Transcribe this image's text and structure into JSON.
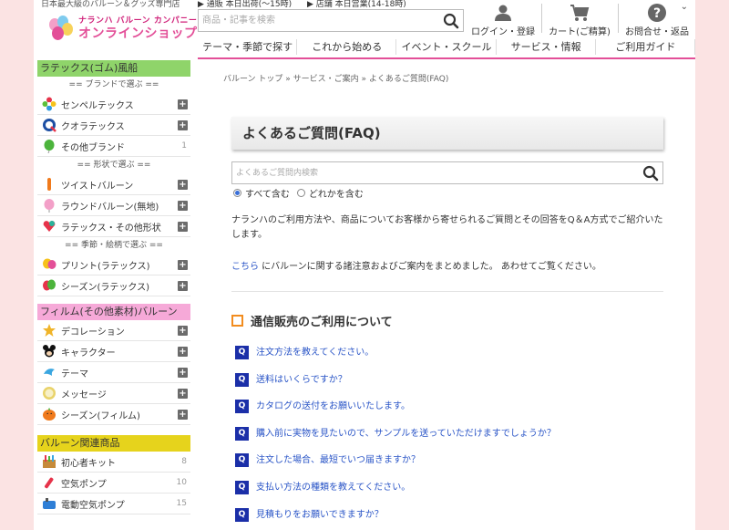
{
  "header": {
    "tagline": "日本最大級のバルーン＆グッズ専門店",
    "logo_top": "ナランハ バルーン カンパニー",
    "logo_bottom": "オンラインショップ",
    "notice_ship": "▶ 通販 本日出荷(〜15時)",
    "notice_store": "▶ 店舗 本日営業(14-18時)",
    "search_placeholder": "商品・記事を検索",
    "login_label": "ログイン・登録",
    "cart_label": "カート(ご精算)",
    "contact_label": "お問合せ・返品",
    "nav": [
      "テーマ・季節で探す",
      "これから始める",
      "イベント・スクール",
      "サービス・情報",
      "ご利用ガイド"
    ]
  },
  "sidebar": {
    "latex": {
      "title": "ラテックス(ゴム)風船",
      "brand_heading": "== ブランドで選ぶ ==",
      "brand_items": [
        {
          "label": "センペルテックス",
          "icon": "sempertex-flower-icon"
        },
        {
          "label": "クオラテックス",
          "icon": "qualatex-logo-icon"
        },
        {
          "label": "その他ブランド",
          "icon": "green-balloon-icon",
          "count": "1"
        }
      ],
      "shape_heading": "== 形状で選ぶ ==",
      "shape_items": [
        {
          "label": "ツイストバルーン",
          "icon": "twist-balloon-icon"
        },
        {
          "label": "ラウンドバルーン(無地)",
          "icon": "round-balloon-icon"
        },
        {
          "label": "ラテックス・その他形状",
          "icon": "heart-balloon-icon"
        }
      ],
      "season_heading": "== 季節・絵柄で選ぶ ==",
      "season_items": [
        {
          "label": "プリント(ラテックス)",
          "icon": "print-balloon-icon"
        },
        {
          "label": "シーズン(ラテックス)",
          "icon": "season-balloon-icon"
        }
      ]
    },
    "film": {
      "title": "フィルム(その他素材)バルーン",
      "items": [
        {
          "label": "デコレーション",
          "icon": "star-balloon-icon"
        },
        {
          "label": "キャラクター",
          "icon": "character-icon"
        },
        {
          "label": "テーマ",
          "icon": "dolphin-balloon-icon"
        },
        {
          "label": "メッセージ",
          "icon": "message-balloon-icon"
        },
        {
          "label": "シーズン(フィルム)",
          "icon": "pumpkin-balloon-icon"
        }
      ]
    },
    "related": {
      "title": "バルーン関連商品",
      "items": [
        {
          "label": "初心者キット",
          "icon": "kit-icon",
          "count": "8"
        },
        {
          "label": "空気ポンプ",
          "icon": "pump-icon",
          "count": "10"
        },
        {
          "label": "電動空気ポンプ",
          "icon": "electric-pump-icon",
          "count": "15"
        }
      ]
    }
  },
  "main": {
    "breadcrumb": "バルーン トップ  »  サービス・ご案内  »  よくあるご質問(FAQ)",
    "title": "よくあるご質問(FAQ)",
    "search_placeholder": "よくあるご質問内検索",
    "radio_all": "すべて含む",
    "radio_any": "どれかを含む",
    "intro": "ナランハのご利用方法や、商品についてお客様から寄せられるご質問とその回答をQ＆A方式でご紹介いたします。",
    "link_text": "こちら",
    "link_after": " にバルーンに関する諸注意およびご案内をまとめました。 あわせてご覧ください。",
    "category_title": "通信販売のご利用について",
    "q_badge": "Q",
    "questions": [
      "注文方法を教えてください。",
      "送料はいくらですか？",
      "カタログの送付をお願いいたします。",
      "購入前に実物を見たいので、サンプルを送っていただけますでしょうか？",
      "注文した場合、最短でいつ届きますか？",
      "支払い方法の種類を教えてください。",
      "見積もりをお願いできますか？"
    ]
  },
  "colors": {
    "latex_header": "#8fd46a",
    "film_header": "#f6a9d8",
    "related_header": "#e6d31c",
    "nav_accent": "#e34f98",
    "link": "#2a55c7",
    "q_badge": "#1b2fa8",
    "category_box": "#f28c1e"
  }
}
